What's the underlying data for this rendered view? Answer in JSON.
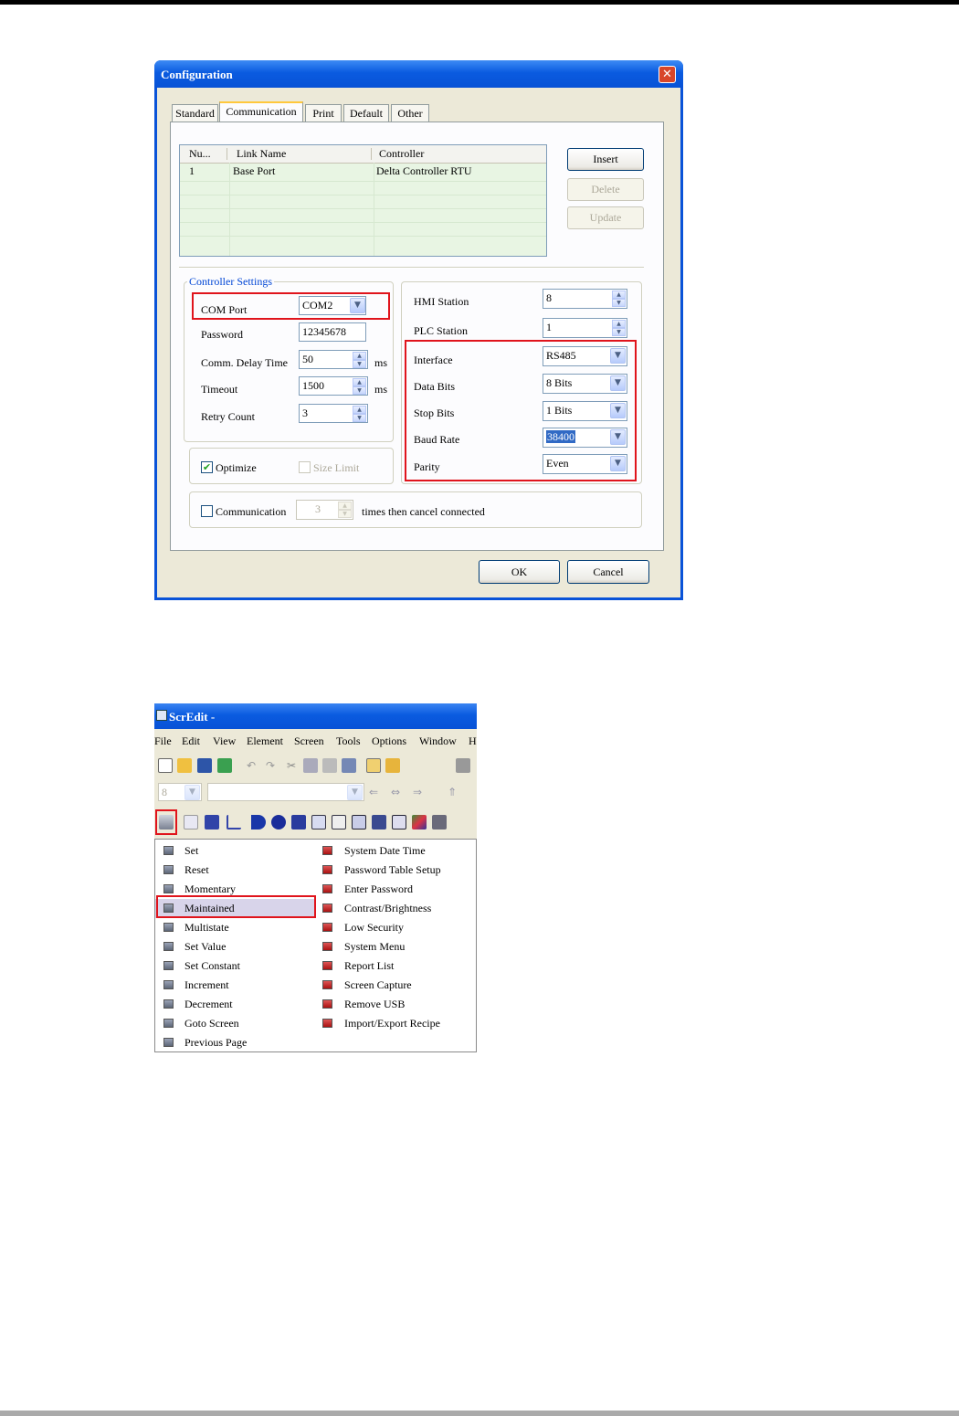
{
  "dialog": {
    "title": "Configuration",
    "close_glyph": "✕",
    "tabs": [
      {
        "label": "Standard",
        "active": false
      },
      {
        "label": "Communication",
        "active": true
      },
      {
        "label": "Print",
        "active": false
      },
      {
        "label": "Default",
        "active": false
      },
      {
        "label": "Other",
        "active": false
      }
    ],
    "link_list": {
      "columns": [
        "Nu...",
        "Link Name",
        "Controller"
      ],
      "rows": [
        [
          "1",
          "Base Port",
          "Delta Controller RTU"
        ]
      ]
    },
    "buttons": {
      "insert": "Insert",
      "delete": "Delete",
      "update": "Update",
      "ok": "OK",
      "cancel": "Cancel"
    },
    "controller_settings": {
      "title": "Controller Settings",
      "com_port_label": "COM Port",
      "com_port_value": "COM2",
      "password_label": "Password",
      "password_value": "12345678",
      "comm_delay_label": "Comm. Delay Time",
      "comm_delay_value": "50",
      "comm_delay_unit": "ms",
      "timeout_label": "Timeout",
      "timeout_value": "1500",
      "timeout_unit": "ms",
      "retry_label": "Retry Count",
      "retry_value": "3"
    },
    "options": {
      "optimize_label": "Optimize",
      "optimize_checked": true,
      "size_limit_label": "Size Limit",
      "size_limit_checked": false
    },
    "right_settings": {
      "hmi_station_label": "HMI Station",
      "hmi_station_value": "8",
      "plc_station_label": "PLC Station",
      "plc_station_value": "1",
      "interface_label": "Interface",
      "interface_value": "RS485",
      "data_bits_label": "Data Bits",
      "data_bits_value": "8 Bits",
      "stop_bits_label": "Stop Bits",
      "stop_bits_value": "1 Bits",
      "baud_rate_label": "Baud Rate",
      "baud_rate_value": "38400",
      "parity_label": "Parity",
      "parity_value": "Even"
    },
    "communication": {
      "checkbox_label": "Communication",
      "times_value": "3",
      "suffix": "times then cancel connected"
    }
  },
  "scredit": {
    "title": "ScrEdit -",
    "menus": [
      "File",
      "Edit",
      "View",
      "Element",
      "Screen",
      "Tools",
      "Options",
      "Window",
      "H"
    ],
    "toolbar2_value": "8",
    "menu_left": [
      "Set",
      "Reset",
      "Momentary",
      "Maintained",
      "Multistate",
      "Set Value",
      "Set Constant",
      "Increment",
      "Decrement",
      "Goto Screen",
      "Previous Page"
    ],
    "menu_right": [
      "System Date Time",
      "Password Table Setup",
      "Enter Password",
      "Contrast/Brightness",
      "Low Security",
      "System Menu",
      "Report List",
      "Screen Capture",
      "Remove USB",
      "Import/Export Recipe"
    ],
    "highlighted_item": "Maintained"
  },
  "colors": {
    "highlight_red": "#e0141c",
    "xp_blue": "#0a53d8",
    "menu_highlight": "#d8d4ea"
  }
}
